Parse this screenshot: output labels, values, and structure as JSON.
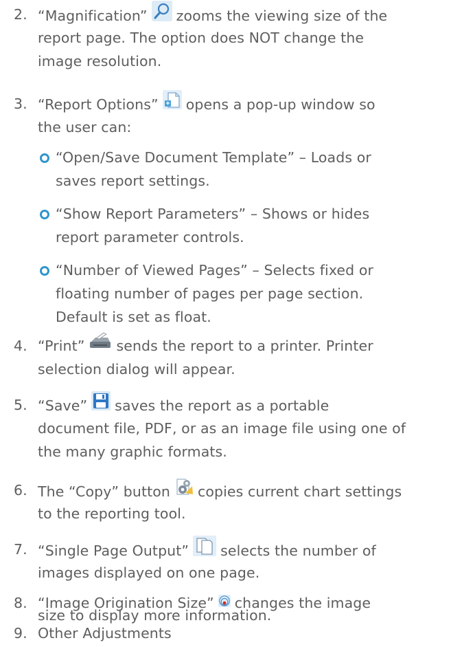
{
  "items": [
    {
      "number": "2.",
      "lines": [
        {
          "pre": "“Magnification”",
          "post": "zooms the viewing size of the"
        },
        {
          "text": "report page. The option does NOT change the"
        },
        {
          "text": "image resolution."
        }
      ],
      "icon": "magnifier-icon"
    },
    {
      "number": "3.",
      "lines": [
        {
          "pre": "“Report Options”",
          "post": "opens a pop-up window so"
        },
        {
          "text": "the user can:"
        }
      ],
      "icon": "report-options-icon",
      "subitems": [
        {
          "lines": [
            "“Open/Save Document Template” – Loads or",
            "saves report settings."
          ]
        },
        {
          "lines": [
            "“Show Report Parameters” – Shows or hides",
            "report parameter controls."
          ]
        },
        {
          "lines": [
            "“Number of Viewed Pages” – Selects fixed or",
            "floating number of pages per page section.",
            "Default is set as float."
          ]
        }
      ]
    },
    {
      "number": "4.",
      "lines": [
        {
          "pre": "“Print”",
          "post": "sends the report to a printer. Printer"
        },
        {
          "text": "selection dialog will appear."
        }
      ],
      "icon": "printer-icon"
    },
    {
      "number": "5.",
      "lines": [
        {
          "pre": "“Save”",
          "post": "saves the report as a portable"
        },
        {
          "text": "document file, PDF, or as an image file using one of"
        },
        {
          "text": "the many graphic formats."
        }
      ],
      "icon": "floppy-disk-icon"
    },
    {
      "number": "6.",
      "lines": [
        {
          "pre": "The “Copy” button",
          "post": "copies current chart settings"
        },
        {
          "text": "to the reporting tool."
        }
      ],
      "icon": "copy-settings-icon"
    },
    {
      "number": "7.",
      "lines": [
        {
          "pre": "“Single Page Output”",
          "post": "selects the number of"
        },
        {
          "text": "images displayed on one page."
        }
      ],
      "icon": "pages-icon"
    },
    {
      "number": "8.",
      "lines": [
        {
          "pre": "“Image Origination Size”",
          "post": "changes the image"
        },
        {
          "text": "size to display more information."
        }
      ],
      "icon": "origination-size-icon"
    },
    {
      "number": "9.",
      "lines": [
        {
          "text": "Other Adjustments"
        }
      ]
    }
  ],
  "colors": {
    "text": "#5e5e5e",
    "bullet": "#2f95cc"
  }
}
